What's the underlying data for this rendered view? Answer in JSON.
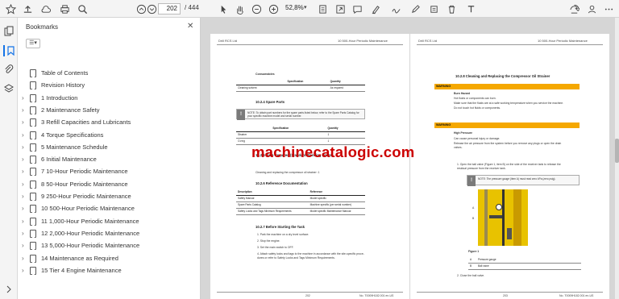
{
  "toolbar": {
    "page_current": "202",
    "page_total": "/ 444",
    "zoom": "52,8%",
    "zoom_caret": "▾",
    "icons": [
      "star-icon",
      "upload-icon",
      "print-icon",
      "search-icon",
      "page-up-icon",
      "page-down-icon",
      "cursor-icon",
      "hand-icon",
      "zoom-out-icon",
      "zoom-in-icon",
      "page-fit-icon",
      "rotate-icon",
      "comment-icon",
      "highlight-icon",
      "sign-icon",
      "draw-icon",
      "stamp-icon",
      "delete-icon",
      "text-edit-icon",
      "share-icon",
      "more-icon"
    ]
  },
  "bookmarks": {
    "title": "Bookmarks",
    "close": "✕",
    "options": "☰▾",
    "items": [
      {
        "label": "Table of Contents",
        "expandable": false
      },
      {
        "label": "Revision History",
        "expandable": false
      },
      {
        "label": "1 Introduction",
        "expandable": true
      },
      {
        "label": "2 Maintenance Safety",
        "expandable": true
      },
      {
        "label": "3 Refill Capacities and Lubricants",
        "expandable": true
      },
      {
        "label": "4 Torque Specifications",
        "expandable": true
      },
      {
        "label": "5 Maintenance Schedule",
        "expandable": true
      },
      {
        "label": "6 Initial Maintenance",
        "expandable": true
      },
      {
        "label": "7 10-Hour Periodic Maintenance",
        "expandable": true
      },
      {
        "label": "8 50-Hour Periodic Maintenance",
        "expandable": true
      },
      {
        "label": "9 250-Hour Periodic Maintenance",
        "expandable": true
      },
      {
        "label": "10 500-Hour Periodic Maintenance",
        "expandable": true
      },
      {
        "label": "11 1,000-Hour Periodic Maintenance",
        "expandable": true
      },
      {
        "label": "12 2,000-Hour Periodic Maintenance",
        "expandable": true
      },
      {
        "label": "13 5,000-Hour Periodic Maintenance",
        "expandable": true
      },
      {
        "label": "14 Maintenance as Required",
        "expandable": true
      },
      {
        "label": "15 Tier 4 Engine Maintenance",
        "expandable": true
      }
    ]
  },
  "left_page": {
    "header_left": "Drill RCS Ltd",
    "header_right": "10 500-Hour Periodic Maintenance",
    "consumables_title": "Consumables",
    "consumables_cols": [
      "",
      "Specification",
      "Quantity"
    ],
    "consumables_rows": [
      [
        "Cleaning solvent",
        "",
        "As required"
      ]
    ],
    "spare_title": "10.2.4 Spare Parts",
    "spare_note": "NOTE: To obtain part numbers for the spare parts listed below, refer to the Spare Parts Catalog for your specific machine model and serial number.",
    "spare_cols": [
      "",
      "Specification",
      "Quantity"
    ],
    "spare_rows": [
      [
        "Strainer",
        "",
        "1"
      ],
      [
        "O-ring",
        "",
        "1"
      ]
    ],
    "time_title": "10.2.5 Time Required (Standard Planning Hours)",
    "time_text": "Cleaning and replacing the compressor oil strainer: 1",
    "ref_title": "10.2.6 Reference Documentation",
    "ref_cols": [
      "Description",
      "Reference"
    ],
    "ref_rows": [
      [
        "Safety Manual",
        "Model specific"
      ],
      [
        "Spare Parts Catalog",
        "Machine specific (per serial number)"
      ],
      [
        "Safety Locks and Tags Minimum Requirements",
        "Model specific Maintenance Manual"
      ]
    ],
    "before_title": "10.2.7 Before Starting the Task",
    "steps": [
      "1.  Park the machine on a dry level surface.",
      "2.  Stop the engine.",
      "3.  Set the main switch to OFF.",
      "4.  Attach safety locks and tags to the machine in accordance with the site-specific proce-",
      "     dures or refer to Safety Locks and Tags Minimum Requirements."
    ],
    "page_number": "202",
    "doc_number": "No. T0009H182.001 en-US"
  },
  "right_page": {
    "header_left": "Drill RCS Ltd",
    "header_right": "10 500-Hour Periodic Maintenance",
    "section_title": "10.2.8 Cleaning and Replacing the Compressor Oil Strainer",
    "warning1": "WARNING",
    "burn_title": "Burn Hazard",
    "burn_lines": [
      "Hot fluids or components can burn.",
      "Make sure that the fluids are at a safe working temperature when you service the machine.",
      "Do not touch hot fluids or components."
    ],
    "warning2": "WARNING",
    "pressure_title": "High Pressure",
    "pressure_lines": [
      "Can cause personal injury or damage.",
      "Release the air pressure from the system before you remove any plugs or open the drain",
      "valves."
    ],
    "step1": "1.  Open the ball valve (Figure 1, item B) on the side of the receiver tank to release the",
    "step1b": "     residual pressure from the receiver tank.",
    "pressure_note": "NOTE: The pressure gauge (item A) must read zero kPa (zero psig).",
    "label_a": "A",
    "label_b": "B",
    "figure_caption": "Figure 1",
    "legend_rows": [
      [
        "A",
        "Pressure gauge"
      ],
      [
        "B",
        "Ball valve"
      ]
    ],
    "step2": "2.  Close the ball valve.",
    "page_number": "203",
    "doc_number": "No. T0009H182.001 en-US"
  },
  "watermark": "machinecatalogic.com"
}
